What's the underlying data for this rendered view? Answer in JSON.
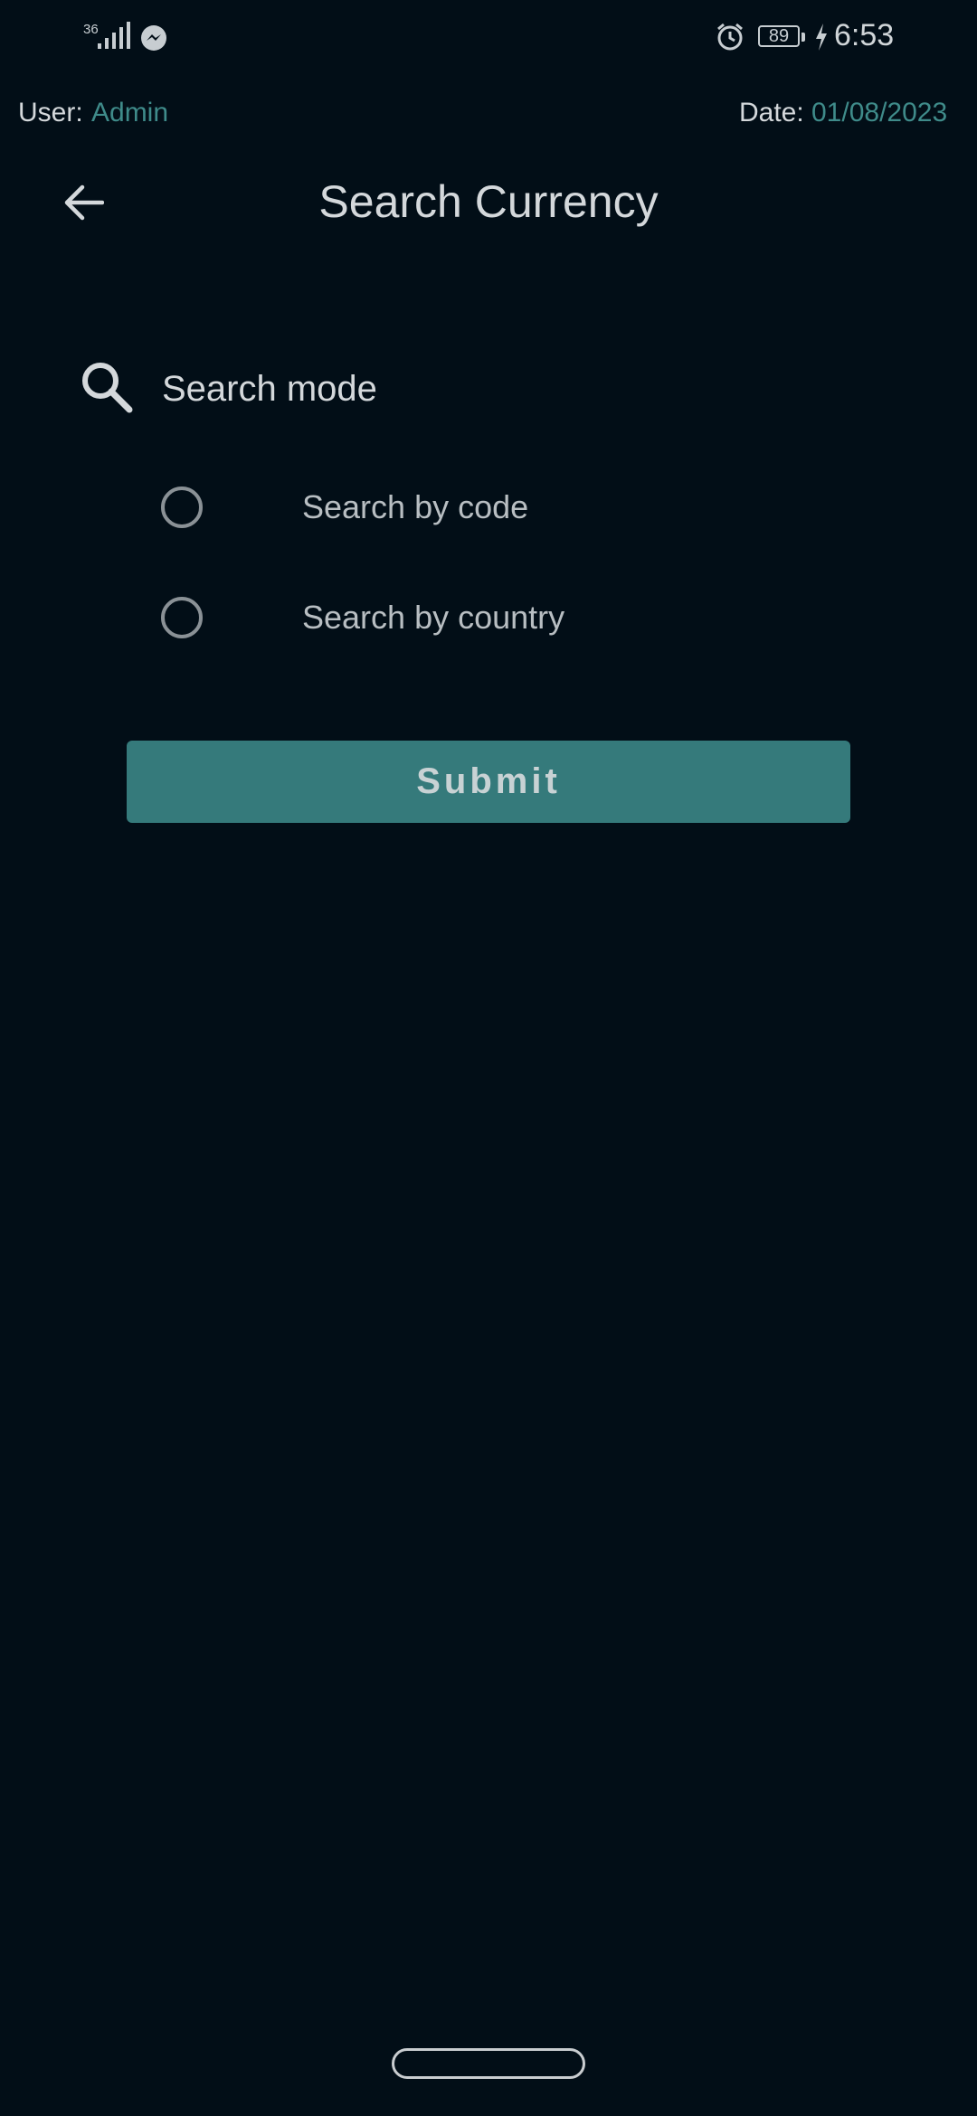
{
  "status_bar": {
    "network": "36",
    "battery": "89",
    "time": "6:53",
    "icons": [
      "signal-icon",
      "messenger-icon",
      "alarm-icon",
      "battery-icon",
      "charging-icon"
    ]
  },
  "info": {
    "user_label": "User:",
    "user_value": "Admin",
    "date_label": "Date:",
    "date_value": "01/08/2023"
  },
  "header": {
    "back_icon": "arrow-left-icon",
    "title": "Search Currency"
  },
  "search": {
    "icon": "search-icon",
    "mode_label": "Search mode",
    "options": [
      {
        "label": "Search by code",
        "selected": false
      },
      {
        "label": "Search by country",
        "selected": false
      }
    ]
  },
  "actions": {
    "submit_label": "Submit"
  },
  "colors": {
    "background": "#020e17",
    "accent": "#357a7b",
    "accent_text": "#3f8b8a",
    "text": "#d4d8db"
  }
}
